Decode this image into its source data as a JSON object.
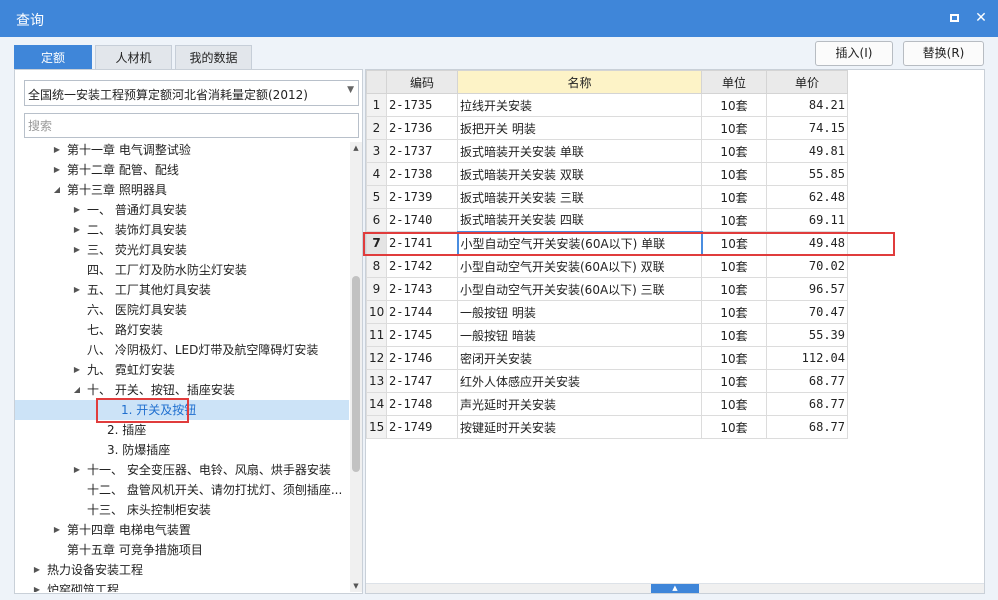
{
  "window": {
    "title": "查询",
    "maximize_icon": "maximize-icon",
    "close_icon": "close-icon",
    "close_glyph": "✕"
  },
  "tabs": [
    {
      "label": "定额",
      "active": true
    },
    {
      "label": "人材机",
      "active": false
    },
    {
      "label": "我的数据",
      "active": false
    }
  ],
  "actions": {
    "insert_label": "插入(I)",
    "replace_label": "替换(R)"
  },
  "library": {
    "selected": "全国统一安装工程预算定额河北省消耗量定额(2012)"
  },
  "search": {
    "placeholder": "搜索",
    "value": ""
  },
  "tree": [
    {
      "label": "第十一章 电气调整试验",
      "arrow": "▶"
    },
    {
      "label": "第十二章 配管、配线",
      "arrow": "▶"
    },
    {
      "label": "第十三章 照明器具",
      "arrow": "◢"
    },
    {
      "label": "一、 普通灯具安装",
      "arrow": "▶"
    },
    {
      "label": "二、 装饰灯具安装",
      "arrow": "▶"
    },
    {
      "label": "三、 荧光灯具安装",
      "arrow": "▶"
    },
    {
      "label": "四、 工厂灯及防水防尘灯安装",
      "arrow": ""
    },
    {
      "label": "五、 工厂其他灯具安装",
      "arrow": "▶"
    },
    {
      "label": "六、 医院灯具安装",
      "arrow": ""
    },
    {
      "label": "七、 路灯安装",
      "arrow": ""
    },
    {
      "label": "八、 冷阴极灯、LED灯带及航空障碍灯安装",
      "arrow": ""
    },
    {
      "label": "九、 霓虹灯安装",
      "arrow": "▶"
    },
    {
      "label": "十、 开关、按钮、插座安装",
      "arrow": "◢"
    },
    {
      "label": "1. 开关及按钮",
      "arrow": "",
      "selected": true
    },
    {
      "label": "2. 插座",
      "arrow": ""
    },
    {
      "label": "3. 防爆插座",
      "arrow": ""
    },
    {
      "label": "十一、 安全变压器、电铃、风扇、烘手器安装",
      "arrow": "▶"
    },
    {
      "label": "十二、 盘管风机开关、请勿打扰灯、须刨插座...",
      "arrow": ""
    },
    {
      "label": "十三、 床头控制柜安装",
      "arrow": ""
    },
    {
      "label": "第十四章 电梯电气装置",
      "arrow": "▶"
    },
    {
      "label": "第十五章 可竞争措施项目",
      "arrow": ""
    },
    {
      "label": "热力设备安装工程",
      "arrow": "▶"
    },
    {
      "label": "炉窑砌筑工程",
      "arrow": "▶"
    }
  ],
  "table": {
    "headers": {
      "code": "编码",
      "name": "名称",
      "unit": "单位",
      "price": "单价"
    },
    "rows": [
      {
        "no": "1",
        "code": "2-1735",
        "name": "拉线开关安装",
        "unit": "10套",
        "price": "84.21"
      },
      {
        "no": "2",
        "code": "2-1736",
        "name": "扳把开关 明装",
        "unit": "10套",
        "price": "74.15"
      },
      {
        "no": "3",
        "code": "2-1737",
        "name": "扳式暗装开关安装 单联",
        "unit": "10套",
        "price": "49.81"
      },
      {
        "no": "4",
        "code": "2-1738",
        "name": "扳式暗装开关安装 双联",
        "unit": "10套",
        "price": "55.85"
      },
      {
        "no": "5",
        "code": "2-1739",
        "name": "扳式暗装开关安装 三联",
        "unit": "10套",
        "price": "62.48"
      },
      {
        "no": "6",
        "code": "2-1740",
        "name": "扳式暗装开关安装 四联",
        "unit": "10套",
        "price": "69.11"
      },
      {
        "no": "7",
        "code": "2-1741",
        "name": "小型自动空气开关安装(60A以下) 单联",
        "unit": "10套",
        "price": "49.48",
        "active": true
      },
      {
        "no": "8",
        "code": "2-1742",
        "name": "小型自动空气开关安装(60A以下) 双联",
        "unit": "10套",
        "price": "70.02"
      },
      {
        "no": "9",
        "code": "2-1743",
        "name": "小型自动空气开关安装(60A以下) 三联",
        "unit": "10套",
        "price": "96.57"
      },
      {
        "no": "10",
        "code": "2-1744",
        "name": "一般按钮 明装",
        "unit": "10套",
        "price": "70.47"
      },
      {
        "no": "11",
        "code": "2-1745",
        "name": "一般按钮 暗装",
        "unit": "10套",
        "price": "55.39"
      },
      {
        "no": "12",
        "code": "2-1746",
        "name": "密闭开关安装",
        "unit": "10套",
        "price": "112.04"
      },
      {
        "no": "13",
        "code": "2-1747",
        "name": "红外人体感应开关安装",
        "unit": "10套",
        "price": "68.77"
      },
      {
        "no": "14",
        "code": "2-1748",
        "name": "声光延时开关安装",
        "unit": "10套",
        "price": "68.77"
      },
      {
        "no": "15",
        "code": "2-1749",
        "name": "按键延时开关安装",
        "unit": "10套",
        "price": "68.77"
      }
    ]
  },
  "colors": {
    "accent": "#3f86d9",
    "highlight_box": "#e03c3c",
    "selected_bg": "#cce3f7",
    "name_header_bg": "#fdf3c7"
  }
}
